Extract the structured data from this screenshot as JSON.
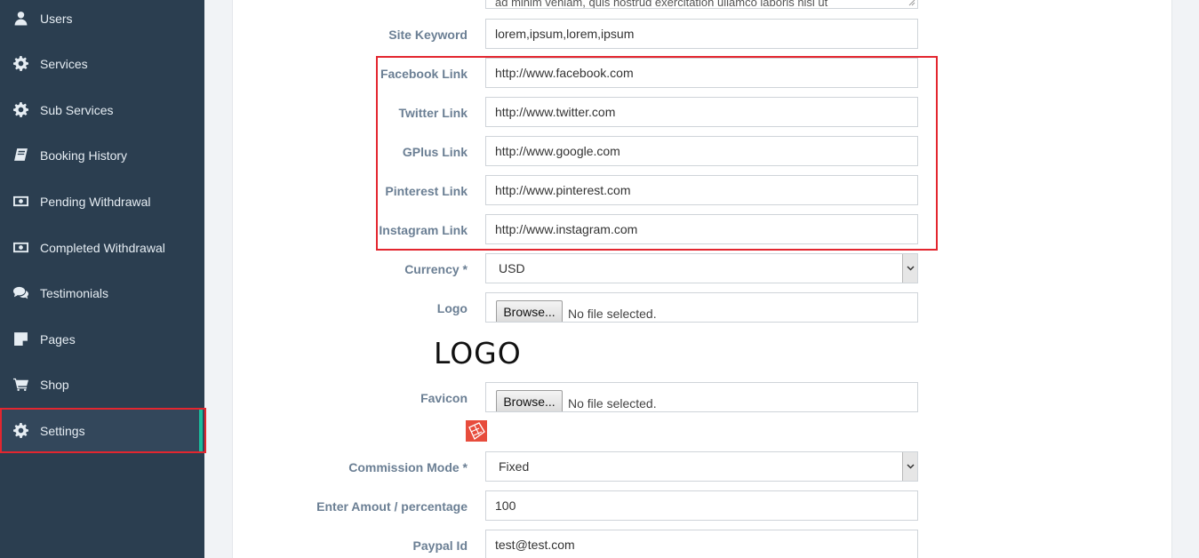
{
  "sidebar": {
    "items": [
      {
        "label": "Users",
        "icon": "user-icon"
      },
      {
        "label": "Services",
        "icon": "gear-icon"
      },
      {
        "label": "Sub Services",
        "icon": "gear-icon"
      },
      {
        "label": "Booking History",
        "icon": "book-icon"
      },
      {
        "label": "Pending Withdrawal",
        "icon": "money-icon"
      },
      {
        "label": "Completed Withdrawal",
        "icon": "money-icon"
      },
      {
        "label": "Testimonials",
        "icon": "comments-icon"
      },
      {
        "label": "Pages",
        "icon": "page-icon"
      },
      {
        "label": "Shop",
        "icon": "cart-icon"
      },
      {
        "label": "Settings",
        "icon": "gear-icon",
        "active": true
      }
    ]
  },
  "form": {
    "description_snippet": "ad minim veniam, quis nostrud exercitation ullamco laboris nisi ut",
    "site_keyword": {
      "label": "Site Keyword",
      "value": "lorem,ipsum,lorem,ipsum"
    },
    "facebook": {
      "label": "Facebook Link",
      "value": "http://www.facebook.com"
    },
    "twitter": {
      "label": "Twitter Link",
      "value": "http://www.twitter.com"
    },
    "gplus": {
      "label": "GPlus Link",
      "value": "http://www.google.com"
    },
    "pinterest": {
      "label": "Pinterest Link",
      "value": "http://www.pinterest.com"
    },
    "instagram": {
      "label": "Instagram Link",
      "value": "http://www.instagram.com"
    },
    "currency": {
      "label": "Currency *",
      "value": "USD"
    },
    "logo": {
      "label": "Logo",
      "button": "Browse...",
      "status": "No file selected.",
      "preview_text": "LOGO"
    },
    "favicon": {
      "label": "Favicon",
      "button": "Browse...",
      "status": "No file selected."
    },
    "commission_mode": {
      "label": "Commission Mode *",
      "value": "Fixed"
    },
    "amount": {
      "label": "Enter Amout / percentage",
      "value": "100"
    },
    "paypal": {
      "label": "Paypal Id",
      "value": "test@test.com"
    }
  },
  "colors": {
    "sidebar_bg": "#2b3e50",
    "active_accent": "#1abc9c",
    "highlight_border": "#e3262f",
    "label_text": "#6b7f94"
  }
}
